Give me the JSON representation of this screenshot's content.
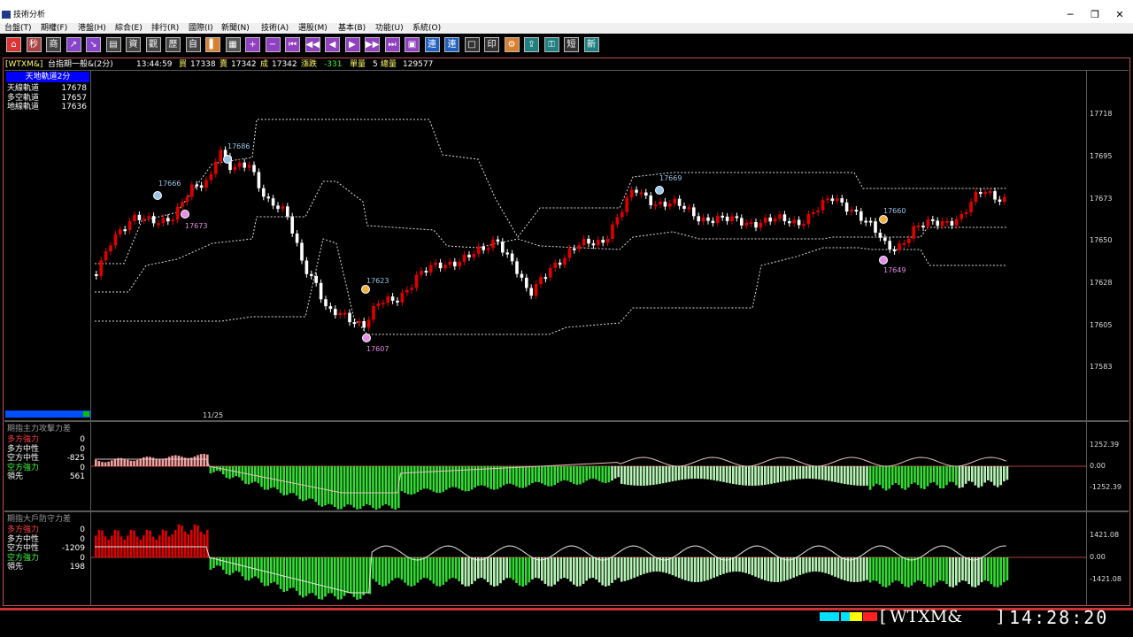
{
  "window": {
    "title": "技術分析",
    "controls": [
      "─",
      "❐",
      "✕"
    ]
  },
  "menu": [
    "台盤(T)",
    "期權(F)",
    "港盤(H)",
    "綜合(E)",
    "排行(R)",
    "國際(I)",
    "新聞(N)",
    "技術(A)",
    "選股(M)",
    "基本(B)",
    "功能(U)",
    "系統(O)"
  ],
  "toolbar": [
    "home-icon",
    "seconds-icon",
    "chart-icon",
    "up-triangle-icon",
    "down-triangle-icon",
    "table-icon",
    "list-icon",
    "history-icon",
    "self-icon",
    "bar-icon",
    "grid-icon",
    "plus-icon",
    "minus-icon",
    "first-icon",
    "prev-fast-icon",
    "prev-icon",
    "next-icon",
    "next-fast-icon",
    "last-icon",
    "window-icon",
    "link-icon",
    "link2-icon",
    "tile-icon",
    "print-icon",
    "config-icon",
    "export-icon",
    "lock-icon",
    "short-icon",
    "new-icon"
  ],
  "toolbar_labels": [
    "⌂",
    "秒",
    "商",
    "↗",
    "↘",
    "▤",
    "資",
    "觀",
    "歷",
    "自",
    "▌",
    "▦",
    "+",
    "−",
    "⏮",
    "◀◀",
    "◀",
    "▶",
    "▶▶",
    "⏭",
    "▣",
    "連",
    "連",
    "□",
    "印",
    "⚙",
    "⇪",
    "⚿",
    "短",
    "新"
  ],
  "quote": {
    "symbol": "[WTXM&]",
    "name": "台指期一般&(2分)",
    "time": "13:44:59",
    "bid_label": "買",
    "bid": "17338",
    "ask_label": "賣",
    "ask": "17342",
    "last_label": "成",
    "last": "17342",
    "change_label": "漲跌",
    "change": "-331",
    "volume_label": "單量",
    "volume": "5",
    "total_label": "總量",
    "total": "129577"
  },
  "main_panel": {
    "title": "天地軌道2分",
    "legend": [
      {
        "label": "天線軌道",
        "value": "17678",
        "color": "#ffffff"
      },
      {
        "label": "多空軌道",
        "value": "17657",
        "color": "#ffffff"
      },
      {
        "label": "地線軌道",
        "value": "17636",
        "color": "#ffffff"
      }
    ],
    "date_label": "11/25",
    "y_ticks": [
      "17718",
      "17695",
      "17673",
      "17650",
      "17628",
      "17605",
      "17583"
    ],
    "annotations": [
      {
        "text": "17666",
        "color": "#9bc4e6"
      },
      {
        "text": "17673",
        "color": "#e48ee4"
      },
      {
        "text": "17686",
        "color": "#9bc4e6"
      },
      {
        "text": "17623",
        "color": "#9bc4e6"
      },
      {
        "text": "17607",
        "color": "#e48ee4"
      },
      {
        "text": "17669",
        "color": "#9bc4e6"
      },
      {
        "text": "17660",
        "color": "#9bc4e6"
      },
      {
        "text": "17649",
        "color": "#e48ee4"
      }
    ]
  },
  "panel2": {
    "title": "期指主力攻擊力差",
    "legend": [
      {
        "label": "多方強力",
        "value": "0",
        "color": "#ff4040"
      },
      {
        "label": "多方中性",
        "value": "0",
        "color": "#ffffff"
      },
      {
        "label": "空方中性",
        "value": "-825",
        "color": "#ffffff"
      },
      {
        "label": "空方強力",
        "value": "0",
        "color": "#40ff40"
      },
      {
        "label": "領先",
        "value": "561",
        "color": "#ffffff"
      }
    ],
    "y_ticks": [
      "1252.39",
      "0.00",
      "-1252.39"
    ]
  },
  "panel3": {
    "title": "期指大戶防守力差",
    "legend": [
      {
        "label": "多方強力",
        "value": "0",
        "color": "#ff4040"
      },
      {
        "label": "多方中性",
        "value": "0",
        "color": "#ffffff"
      },
      {
        "label": "空方中性",
        "value": "-1209",
        "color": "#ffffff"
      },
      {
        "label": "空方強力",
        "value": "0",
        "color": "#40ff40"
      },
      {
        "label": "領先",
        "value": "198",
        "color": "#ffffff"
      }
    ],
    "y_ticks": [
      "1421.08",
      "0.00",
      "-1421.08"
    ]
  },
  "statusbar": {
    "symbol": "WTXM&",
    "clock": "14:28:20"
  },
  "colors": {
    "up": "#e00000",
    "down": "#ffffff",
    "band": "#dddddd",
    "strong_short": "#33dd33",
    "neutral_short": "#b6f5b6",
    "strong_long": "#e00000",
    "neutral_long": "#f5a0a0"
  }
}
